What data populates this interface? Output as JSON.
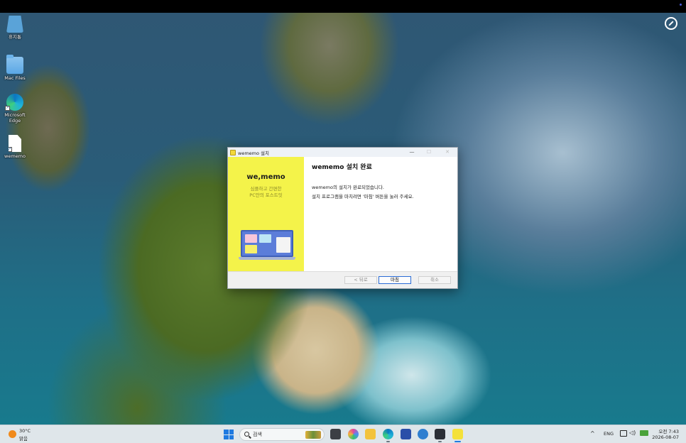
{
  "desktop": {
    "icons": [
      {
        "label": "휴지통"
      },
      {
        "label": "Mac Files"
      },
      {
        "label": "Microsoft\nEdge"
      },
      {
        "label": "wememo"
      }
    ]
  },
  "installer": {
    "window_title": "wememo 설치",
    "brand": "we,memo",
    "tagline": "심플하고 간편한\nPC안의 포스트잇",
    "heading": "wememo 설치 완료",
    "message_line1": "wememo의 설치가 완료되었습니다.",
    "message_line2": "설치 프로그램을 마치려면 '마침' 버튼을 눌러 주세요.",
    "buttons": {
      "back": "< 뒤로",
      "finish": "마침",
      "cancel": "취소"
    }
  },
  "taskbar": {
    "weather_temp": "30°C",
    "weather_desc": "맑음",
    "search_label": "검색",
    "language": "ENG",
    "time": "오전 7:43",
    "date": "2026-08-07"
  },
  "colors": {
    "side_panel": "#f4f34a",
    "accent": "#1f7ae0"
  }
}
